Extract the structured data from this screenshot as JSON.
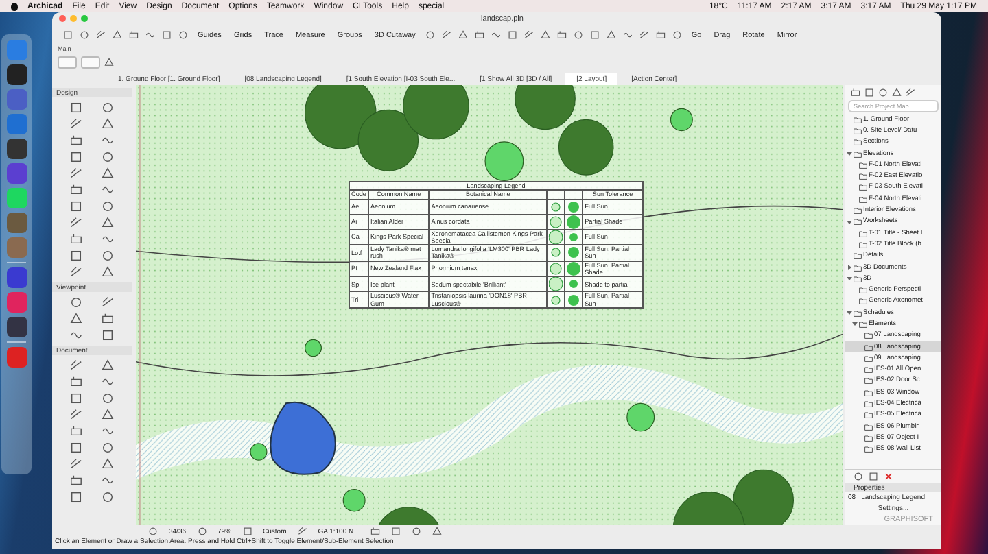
{
  "menu_bar": {
    "app": "Archicad",
    "items": [
      "File",
      "Edit",
      "View",
      "Design",
      "Document",
      "Options",
      "Teamwork",
      "Window",
      "CI Tools",
      "Help",
      "special"
    ],
    "status": [
      "18°C",
      "11:17 AM",
      "2:17 AM",
      "3:17 AM",
      "3:17 AM",
      "Thu 29 May  1:17 PM"
    ]
  },
  "window": {
    "title": "landscap.pln"
  },
  "toolbar": {
    "buttons": [
      "Guides",
      "Grids",
      "Trace",
      "Measure",
      "Groups",
      "3D Cutaway",
      "Go",
      "Drag",
      "Rotate",
      "Mirror"
    ],
    "palette_label": "Main"
  },
  "tabs": [
    {
      "label": "1. Ground Floor [1. Ground Floor]",
      "selected": false
    },
    {
      "label": "[08 Landscaping Legend]",
      "selected": false
    },
    {
      "label": "[1 South Elevation [I-03 South Ele...",
      "selected": false
    },
    {
      "label": "[1 Show All 3D [3D / All]",
      "selected": false
    },
    {
      "label": "[2 Layout]",
      "selected": true
    },
    {
      "label": "[Action Center]",
      "selected": false
    }
  ],
  "toolbox": [
    {
      "title": "Design",
      "expanded": true
    },
    {
      "title": "Viewpoint",
      "expanded": true
    },
    {
      "title": "Document",
      "expanded": true
    }
  ],
  "legend": {
    "title": "Landscaping Legend",
    "columns": [
      "Code",
      "Common Name",
      "Botanical Name",
      "Sun Tolerance"
    ],
    "rows": [
      {
        "code": "Ae",
        "common": "Aeonium",
        "botanical": "Aeonium canariense",
        "sun": "Full Sun"
      },
      {
        "code": "Ai",
        "common": "Italian Alder",
        "botanical": "Alnus cordata",
        "sun": "Partial Shade"
      },
      {
        "code": "Ca",
        "common": "Kings Park Special",
        "botanical": "Xeronematacea Callistemon Kings Park Special",
        "sun": "Full Sun"
      },
      {
        "code": "Lo.f",
        "common": "Lady Tanika® mat rush",
        "botanical": "Lomandra longifolia 'LM300' PBR Lady Tanika®",
        "sun": "Full Sun, Partial Sun"
      },
      {
        "code": "Pt",
        "common": "New Zealand Flax",
        "botanical": "Phormium tenax",
        "sun": "Full Sun, Partial Shade"
      },
      {
        "code": "Sp",
        "common": "Ice plant",
        "botanical": "Sedum spectabile 'Brilliant'",
        "sun": "Shade to partial"
      },
      {
        "code": "Tri",
        "common": "Luscious® Water Gum",
        "botanical": "Tristaniopsis laurina 'DON18' PBR Luscious®",
        "sun": "Full Sun, Partial Sun"
      }
    ]
  },
  "navigator": {
    "search_placeholder": "Search Project Map",
    "items": [
      {
        "label": "1. Ground Floor",
        "selected": false
      },
      {
        "label": "0. Site Level/ Datu",
        "selected": false
      },
      {
        "label": "Sections",
        "selected": false
      },
      {
        "label": "Elevations",
        "selected": false,
        "expanded": true,
        "children": [
          {
            "label": "F-01 North Elevati",
            "selected": false
          },
          {
            "label": "F-02 East Elevatio",
            "selected": false
          },
          {
            "label": "F-03 South Elevati",
            "selected": false
          },
          {
            "label": "F-04 North Elevati",
            "selected": false
          }
        ]
      },
      {
        "label": "Interior Elevations",
        "selected": false
      },
      {
        "label": "Worksheets",
        "selected": false,
        "expanded": true,
        "children": [
          {
            "label": "T-01 Title - Sheet I",
            "selected": false
          },
          {
            "label": "T-02 Title Block (b",
            "selected": false
          }
        ]
      },
      {
        "label": "Details",
        "selected": false
      },
      {
        "label": "3D Documents",
        "selected": false,
        "expanded": false
      },
      {
        "label": "3D",
        "selected": false,
        "expanded": true,
        "children": [
          {
            "label": "Generic Perspecti",
            "selected": false
          },
          {
            "label": "Generic Axonomet",
            "selected": false
          }
        ]
      },
      {
        "label": "Schedules",
        "selected": false,
        "expanded": true,
        "children": [
          {
            "label": "Elements",
            "selected": false,
            "expanded": true,
            "children": [
              {
                "label": "07 Landscaping",
                "selected": false
              },
              {
                "label": "08 Landscaping",
                "selected": true
              },
              {
                "label": "09 Landscaping",
                "selected": false
              },
              {
                "label": "IES-01 All Open",
                "selected": false
              },
              {
                "label": "IES-02 Door Sc",
                "selected": false
              },
              {
                "label": "IES-03 Window",
                "selected": false
              },
              {
                "label": "IES-04 Electrica",
                "selected": false
              },
              {
                "label": "IES-05 Electrica",
                "selected": false
              },
              {
                "label": "IES-06 Plumbin",
                "selected": false
              },
              {
                "label": "IES-07 Object I",
                "selected": false
              },
              {
                "label": "IES-08 Wall List",
                "selected": false
              }
            ]
          }
        ]
      }
    ],
    "properties": {
      "title": "Properties",
      "id": "08",
      "name": "Landscaping Legend",
      "settings": "Settings...",
      "brand": "GRAPHISOFT"
    }
  },
  "status_bar": {
    "page": "34/36",
    "zoom": "79%",
    "layer": "Custom",
    "scale": "GA 1:100 N...",
    "message": "Click an Element or Draw a Selection Area. Press and Hold Ctrl+Shift to Toggle Element/Sub-Element Selection"
  }
}
